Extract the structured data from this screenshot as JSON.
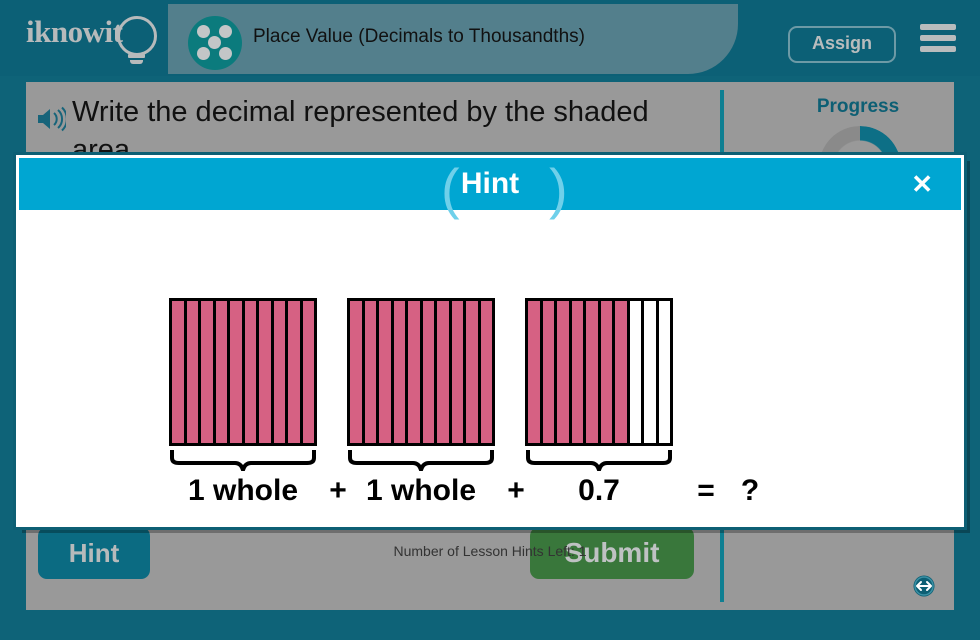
{
  "header": {
    "logo_text": "iknowit",
    "logo_icon": "lightbulb-icon",
    "lesson_title": "Place Value (Decimals to Thousandths)",
    "assign_label": "Assign",
    "menu_icon": "hamburger-menu-icon",
    "badge_icon": "five-dot-badge-icon"
  },
  "question": {
    "speaker_icon": "speaker-audio-icon",
    "text": "Write the decimal represented by the shaded area.",
    "hint_label": "Hint",
    "submit_label": "Submit",
    "resize_icon": "resize-horizontal-icon"
  },
  "progress": {
    "label": "Progress",
    "percent": 25
  },
  "hint_modal": {
    "title": "Hint",
    "close_icon": "close-x-icon",
    "paren_left": "(",
    "paren_right": ")",
    "hints_left_text": "Number of Lesson Hints Left: 1",
    "equation": {
      "term1": "1 whole",
      "plus1": "+",
      "term2": "1 whole",
      "plus2": "+",
      "term3": "0.7",
      "equals": "=",
      "answer": "?"
    },
    "grids": [
      {
        "name": "grid-1",
        "columns": 10,
        "shaded": 10,
        "value": "1 whole"
      },
      {
        "name": "grid-2",
        "columns": 10,
        "shaded": 10,
        "value": "1 whole"
      },
      {
        "name": "grid-3",
        "columns": 10,
        "shaded": 7,
        "value": "0.7"
      }
    ]
  },
  "colors": {
    "page_background": "#0e6378",
    "panel_background": "#999999",
    "header_teal": "#0c6076",
    "title_pill": "#537f8c",
    "modal_header_cyan": "#00a6d2",
    "shaded_pink": "#d66183",
    "submit_green": "#39773b",
    "hint_teal": "#0b6b82",
    "progress_teal": "#0d6f86"
  }
}
